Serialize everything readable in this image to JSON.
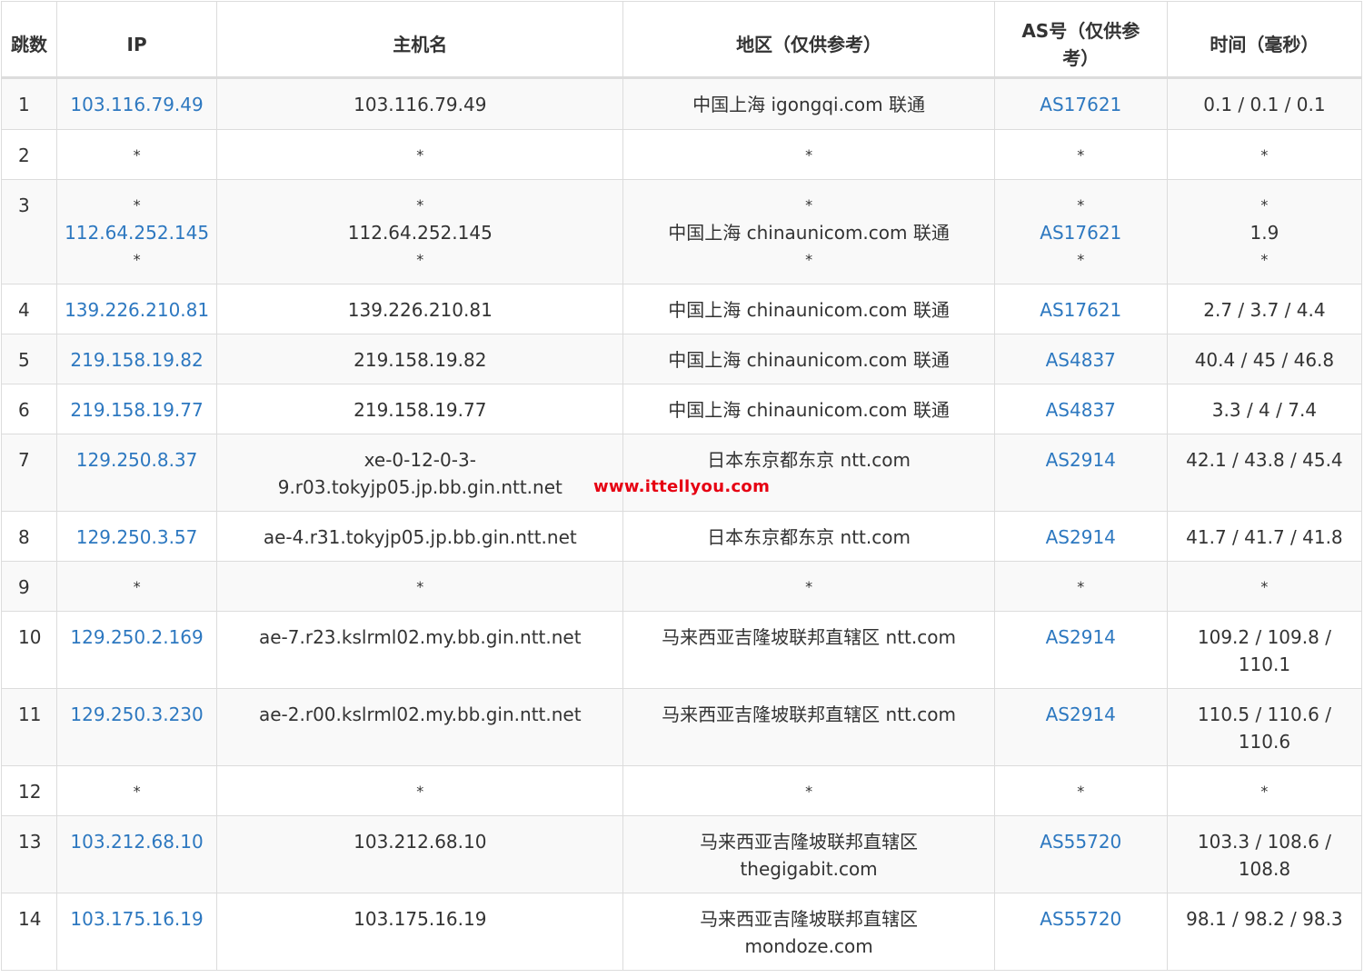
{
  "headers": {
    "hop": "跳数",
    "ip": "IP",
    "hostname": "主机名",
    "region": "地区（仅供参考）",
    "asn": "AS号（仅供参考）",
    "time": "时间（毫秒）"
  },
  "rows": [
    {
      "hop": "1",
      "ip": [
        "103.116.79.49"
      ],
      "host": [
        "103.116.79.49"
      ],
      "region": [
        "中国上海 igongqi.com 联通"
      ],
      "asn": [
        "AS17621"
      ],
      "time": [
        "0.1 / 0.1 / 0.1"
      ]
    },
    {
      "hop": "2",
      "ip": [
        "*"
      ],
      "host": [
        "*"
      ],
      "region": [
        "*"
      ],
      "asn": [
        "*"
      ],
      "time": [
        "*"
      ]
    },
    {
      "hop": "3",
      "ip": [
        "*",
        "112.64.252.145",
        "*"
      ],
      "host": [
        "*",
        "112.64.252.145",
        "*"
      ],
      "region": [
        "*",
        "中国上海 chinaunicom.com 联通",
        "*"
      ],
      "asn": [
        "*",
        "AS17621",
        "*"
      ],
      "time": [
        "*",
        "1.9",
        "*"
      ]
    },
    {
      "hop": "4",
      "ip": [
        "139.226.210.81"
      ],
      "host": [
        "139.226.210.81"
      ],
      "region": [
        "中国上海 chinaunicom.com 联通"
      ],
      "asn": [
        "AS17621"
      ],
      "time": [
        "2.7 / 3.7 / 4.4"
      ]
    },
    {
      "hop": "5",
      "ip": [
        "219.158.19.82"
      ],
      "host": [
        "219.158.19.82"
      ],
      "region": [
        "中国上海 chinaunicom.com 联通"
      ],
      "asn": [
        "AS4837"
      ],
      "time": [
        "40.4 / 45 / 46.8"
      ]
    },
    {
      "hop": "6",
      "ip": [
        "219.158.19.77"
      ],
      "host": [
        "219.158.19.77"
      ],
      "region": [
        "中国上海 chinaunicom.com 联通"
      ],
      "asn": [
        "AS4837"
      ],
      "time": [
        "3.3 / 4 / 7.4"
      ]
    },
    {
      "hop": "7",
      "ip": [
        "129.250.8.37"
      ],
      "host": [
        "xe-0-12-0-3-",
        "9.r03.tokyjp05.jp.bb.gin.ntt.net"
      ],
      "region": [
        "日本东京都东京 ntt.com"
      ],
      "asn": [
        "AS2914"
      ],
      "time": [
        "42.1 / 43.8 / 45.4"
      ]
    },
    {
      "hop": "8",
      "ip": [
        "129.250.3.57"
      ],
      "host": [
        "ae-4.r31.tokyjp05.jp.bb.gin.ntt.net"
      ],
      "region": [
        "日本东京都东京 ntt.com"
      ],
      "asn": [
        "AS2914"
      ],
      "time": [
        "41.7 / 41.7 / 41.8"
      ]
    },
    {
      "hop": "9",
      "ip": [
        "*"
      ],
      "host": [
        "*"
      ],
      "region": [
        "*"
      ],
      "asn": [
        "*"
      ],
      "time": [
        "*"
      ]
    },
    {
      "hop": "10",
      "ip": [
        "129.250.2.169"
      ],
      "host": [
        "ae-7.r23.kslrml02.my.bb.gin.ntt.net"
      ],
      "region": [
        "马来西亚吉隆坡联邦直辖区 ntt.com"
      ],
      "asn": [
        "AS2914"
      ],
      "time": [
        "109.2 / 109.8 /",
        "110.1"
      ]
    },
    {
      "hop": "11",
      "ip": [
        "129.250.3.230"
      ],
      "host": [
        "ae-2.r00.kslrml02.my.bb.gin.ntt.net"
      ],
      "region": [
        "马来西亚吉隆坡联邦直辖区 ntt.com"
      ],
      "asn": [
        "AS2914"
      ],
      "time": [
        "110.5 / 110.6 /",
        "110.6"
      ]
    },
    {
      "hop": "12",
      "ip": [
        "*"
      ],
      "host": [
        "*"
      ],
      "region": [
        "*"
      ],
      "asn": [
        "*"
      ],
      "time": [
        "*"
      ]
    },
    {
      "hop": "13",
      "ip": [
        "103.212.68.10"
      ],
      "host": [
        "103.212.68.10"
      ],
      "region": [
        "马来西亚吉隆坡联邦直辖区",
        "thegigabit.com"
      ],
      "asn": [
        "AS55720"
      ],
      "time": [
        "103.3 / 108.6 /",
        "108.8"
      ]
    },
    {
      "hop": "14",
      "ip": [
        "103.175.16.19"
      ],
      "host": [
        "103.175.16.19"
      ],
      "region": [
        "马来西亚吉隆坡联邦直辖区",
        "mondoze.com"
      ],
      "asn": [
        "AS55720"
      ],
      "time": [
        "98.1 / 98.2 / 98.3"
      ]
    }
  ],
  "watermark": "www.ittellyou.com",
  "colors": {
    "link": "#2d78c0",
    "watermark": "#e60012",
    "stripe": "#f9f9f9",
    "border": "#dcdcdc"
  }
}
